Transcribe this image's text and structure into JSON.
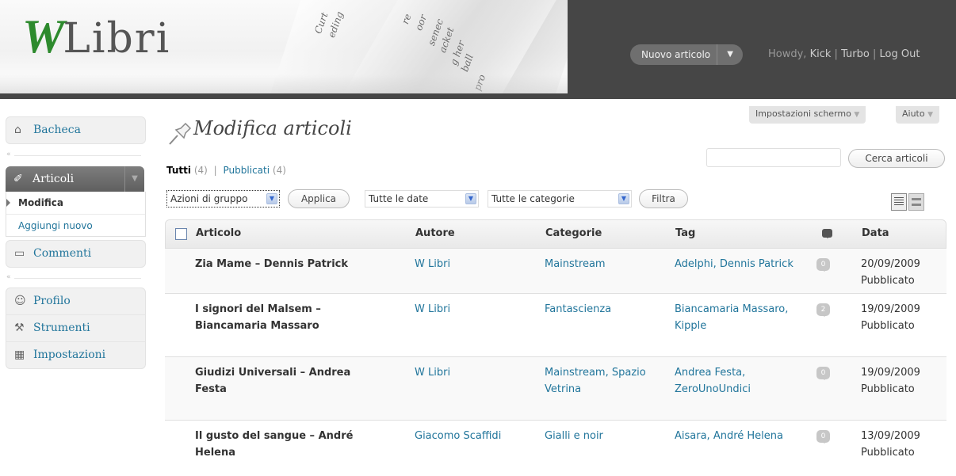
{
  "header": {
    "logo_w": "W",
    "logo_text": "Libri",
    "new_post_label": "Nuovo articolo",
    "greeting": "Howdy,",
    "user": "Kick",
    "links": [
      "Turbo",
      "Log Out"
    ],
    "separator": "|",
    "decor_words": [
      "Curt",
      "eding",
      "re",
      "oor",
      "senec",
      "acket",
      "g her",
      "ball",
      "pro"
    ]
  },
  "screen_options": {
    "label": "Impostazioni schermo",
    "help": "Aiuto"
  },
  "sidebar": {
    "dashboard": "Bacheca",
    "posts": "Articoli",
    "posts_sub": [
      "Modifica",
      "Aggiungi nuovo"
    ],
    "comments": "Commenti",
    "bottom": [
      "Profilo",
      "Strumenti",
      "Impostazioni"
    ],
    "collapse_glyph": "«"
  },
  "page": {
    "title": "Modifica articoli",
    "filter_all": "Tutti",
    "filter_all_count": "(4)",
    "filter_pub": "Pubblicati",
    "filter_pub_count": "(4)",
    "filter_sep": "|",
    "search_button": "Cerca articoli",
    "bulk_actions": "Azioni di gruppo",
    "apply": "Applica",
    "dates": "Tutte le date",
    "categories": "Tutte le categorie",
    "filter_button": "Filtra"
  },
  "table": {
    "headers": {
      "title": "Articolo",
      "author": "Autore",
      "categories": "Categorie",
      "tags": "Tag",
      "date": "Data"
    },
    "rows": [
      {
        "title": "Zia Mame – Dennis Patrick",
        "author": "W Libri",
        "categories": "Mainstream",
        "tags": "Adelphi, Dennis Patrick",
        "comments": "0",
        "date": "20/09/2009",
        "status": "Pubblicato"
      },
      {
        "title": "I signori del Malsem – Biancamaria Massaro",
        "author": "W Libri",
        "categories": "Fantascienza",
        "tags": "Biancamaria Massaro, Kipple",
        "comments": "2",
        "date": "19/09/2009",
        "status": "Pubblicato"
      },
      {
        "title": "Giudizi Universali – Andrea Festa",
        "author": "W Libri",
        "categories": "Mainstream, Spazio Vetrina",
        "tags": "Andrea Festa, ZeroUnoUndici",
        "comments": "0",
        "date": "19/09/2009",
        "status": "Pubblicato"
      },
      {
        "title": "Il gusto del sangue – André Helena",
        "author": "Giacomo Scaffidi",
        "categories": "Gialli e noir",
        "tags": "Aisara, André Helena",
        "comments": "0",
        "date": "13/09/2009",
        "status": "Pubblicato"
      }
    ]
  }
}
